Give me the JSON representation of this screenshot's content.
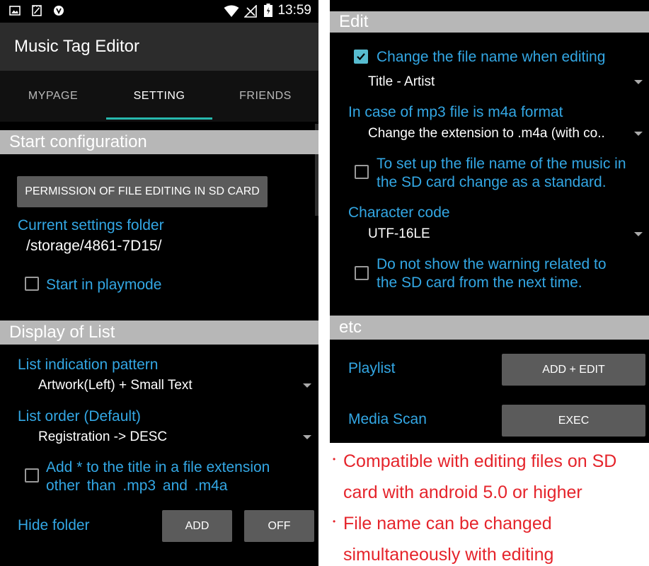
{
  "status_bar": {
    "time": "13:59",
    "icons": [
      "image-icon",
      "notes-icon",
      "shield-icon",
      "wifi-icon",
      "no-signal-icon",
      "battery-icon"
    ]
  },
  "app_bar": {
    "title": "Music Tag Editor"
  },
  "tabs": [
    {
      "label": "MYPAGE",
      "active": false
    },
    {
      "label": "SETTING",
      "active": true
    },
    {
      "label": "FRIENDS",
      "active": false
    }
  ],
  "start_config": {
    "header": "Start configuration",
    "permission_button": "PERMISSION OF FILE EDITING IN SD CARD",
    "current_folder_label": "Current settings folder",
    "current_folder_value": "/storage/4861-7D15/",
    "playmode_label": "Start in playmode",
    "playmode_checked": false
  },
  "display_list": {
    "header": "Display of List",
    "pattern_label": "List indication pattern",
    "pattern_value": "Artwork(Left) + Small Text",
    "order_label": "List order (Default)",
    "order_value": "Registration -> DESC",
    "add_star_line1": "Add * to the title in a file extension",
    "add_star_line2": "other than .mp3 and .m4a",
    "add_star_checked": false,
    "hide_folder_label": "Hide folder",
    "add_button": "ADD",
    "off_button": "OFF"
  },
  "edit": {
    "header": "Edit",
    "change_filename_label": "Change the file name when editing",
    "change_filename_checked": true,
    "filename_pattern_value": "Title - Artist",
    "mp3_m4a_label": "In case of mp3 file is m4a format",
    "mp3_m4a_value": "Change the extension to .m4a (with co..",
    "sd_standard_line1": "To set up the file name of the music in",
    "sd_standard_line2": "the SD card change as a standard.",
    "sd_standard_checked": false,
    "charset_label": "Character code",
    "charset_value": "UTF-16LE",
    "warning_line1": "Do not show the warning related to",
    "warning_line2": "the SD card from the next time.",
    "warning_checked": false
  },
  "etc": {
    "header": "etc",
    "playlist_label": "Playlist",
    "playlist_button": "ADD + EDIT",
    "media_scan_label": "Media Scan",
    "media_scan_button": "EXEC"
  },
  "notes": {
    "note1_line1": "Compatible with editing files on SD",
    "note1_line2": "card with android 5.0 or higher",
    "note2_line1": "File name can be changed",
    "note2_line2": "simultaneously with editing"
  },
  "colors": {
    "accent_blue": "#33a7e4",
    "tab_indicator": "#27b8ad",
    "checkbox_checked": "#57bcd0",
    "note_red": "#e5242b",
    "section_header_gray": "#b7b7b7"
  }
}
